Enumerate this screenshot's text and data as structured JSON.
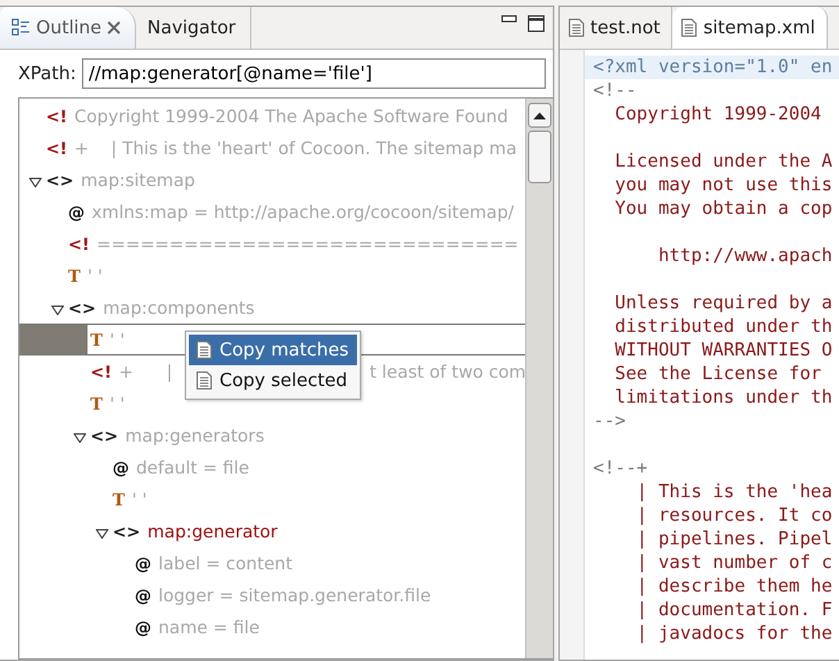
{
  "outline_view": {
    "tabs": [
      {
        "label": "Outline",
        "selected": true,
        "closable": true
      },
      {
        "label": "Navigator",
        "selected": false,
        "closable": false
      }
    ],
    "xpath": {
      "label": "XPath:",
      "value": "//map:generator[@name='file']"
    },
    "tree": [
      {
        "kind": "comment",
        "icon": "<!",
        "segments": [
          "Copyright 1999-2004 The Apache Software Found"
        ],
        "selected": false
      },
      {
        "kind": "comment",
        "icon": "<!",
        "segments": [
          "+    | This is the 'heart' of Cocoon. The sitemap ma"
        ],
        "selected": false
      },
      {
        "kind": "element",
        "icon": "<>",
        "segments": [
          "map:sitemap"
        ],
        "selected": false,
        "expanded": true,
        "match": false,
        "children": [
          {
            "kind": "attribute",
            "icon": "@",
            "segments": [
              "xmlns:map = http://apache.org/cocoon/sitemap/"
            ],
            "selected": false
          },
          {
            "kind": "comment",
            "icon": "<!",
            "segments": [
              "============================="
            ],
            "selected": false
          },
          {
            "kind": "text",
            "icon": "T",
            "segments": [
              "' '"
            ],
            "selected": false
          },
          {
            "kind": "element",
            "icon": "<>",
            "segments": [
              "map:components"
            ],
            "selected": false,
            "expanded": true,
            "match": false,
            "children": [
              {
                "kind": "text",
                "icon": "T",
                "segments": [
                  "' '"
                ],
                "selected": true
              },
              {
                "kind": "comment",
                "icon": "<!",
                "segments": [
                  "+      |",
                  "t least of two com"
                ],
                "selected": false
              },
              {
                "kind": "text",
                "icon": "T",
                "segments": [
                  "' '"
                ],
                "selected": false
              },
              {
                "kind": "element",
                "icon": "<>",
                "segments": [
                  "map:generators"
                ],
                "selected": false,
                "expanded": true,
                "match": false,
                "children": [
                  {
                    "kind": "attribute",
                    "icon": "@",
                    "segments": [
                      "default = file"
                    ],
                    "selected": false
                  },
                  {
                    "kind": "text",
                    "icon": "T",
                    "segments": [
                      "' '"
                    ],
                    "selected": false
                  },
                  {
                    "kind": "element",
                    "icon": "<>",
                    "segments": [
                      "map:generator"
                    ],
                    "selected": false,
                    "expanded": true,
                    "match": true,
                    "children": [
                      {
                        "kind": "attribute",
                        "icon": "@",
                        "segments": [
                          "label = content"
                        ],
                        "selected": false
                      },
                      {
                        "kind": "attribute",
                        "icon": "@",
                        "segments": [
                          "logger = sitemap.generator.file"
                        ],
                        "selected": false
                      },
                      {
                        "kind": "attribute",
                        "icon": "@",
                        "segments": [
                          "name = file"
                        ],
                        "selected": false
                      }
                    ]
                  }
                ]
              }
            ]
          }
        ]
      }
    ],
    "context_menu": [
      {
        "label": "Copy matches",
        "selected": true
      },
      {
        "label": "Copy selected",
        "selected": false
      }
    ]
  },
  "editor": {
    "tabs": [
      {
        "label": "test.not",
        "selected": false
      },
      {
        "label": "sitemap.xml",
        "selected": true
      }
    ],
    "lines": [
      {
        "kind": "pi",
        "text": "<?xml version=\"1.0\" en"
      },
      {
        "kind": "delim",
        "text": "<!--"
      },
      {
        "kind": "comment",
        "text": "  Copyright 1999-2004"
      },
      {
        "kind": "blank"
      },
      {
        "kind": "comment",
        "text": "  Licensed under the A"
      },
      {
        "kind": "comment",
        "text": "  you may not use this"
      },
      {
        "kind": "comment",
        "text": "  You may obtain a cop"
      },
      {
        "kind": "blank"
      },
      {
        "kind": "comment",
        "text": "      http://www.apach"
      },
      {
        "kind": "blank"
      },
      {
        "kind": "comment",
        "text": "  Unless required by a"
      },
      {
        "kind": "comment",
        "text": "  distributed under th"
      },
      {
        "kind": "comment",
        "text": "  WITHOUT WARRANTIES O"
      },
      {
        "kind": "comment",
        "text": "  See the License for"
      },
      {
        "kind": "comment",
        "text": "  limitations under th"
      },
      {
        "kind": "delim",
        "text": "-->"
      },
      {
        "kind": "blank"
      },
      {
        "kind": "delim",
        "text": "<!--+"
      },
      {
        "kind": "comment",
        "text": "    | This is the 'hea"
      },
      {
        "kind": "comment",
        "text": "    | resources. It co"
      },
      {
        "kind": "comment",
        "text": "    | pipelines. Pipel"
      },
      {
        "kind": "comment",
        "text": "    | vast number of c"
      },
      {
        "kind": "comment",
        "text": "    | describe them he"
      },
      {
        "kind": "comment",
        "text": "    | documentation. F"
      },
      {
        "kind": "comment",
        "text": "    | javadocs for the"
      }
    ]
  }
}
